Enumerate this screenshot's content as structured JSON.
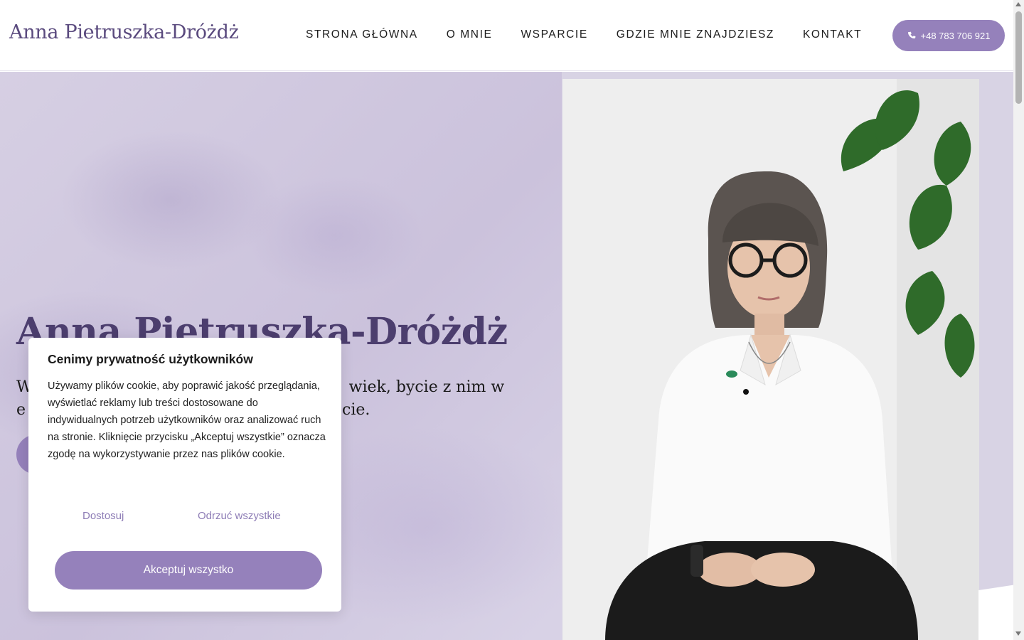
{
  "header": {
    "logo": "Anna Pietruszka-Dróżdż",
    "nav": [
      "STRONA GŁÓWNA",
      "O MNIE",
      "WSPARCIE",
      "GDZIE MNIE ZNAJDZIESZ",
      "KONTAKT"
    ],
    "phone": "+48 783 706 921",
    "phone_icon": "phone-icon"
  },
  "hero": {
    "title": "Anna Pietruszka-Dróżdż",
    "subtitle_line1": "W",
    "subtitle_line1_end": "wiek, bycie z nim w",
    "subtitle_line2": "e",
    "subtitle_line2_end": "cie."
  },
  "cookie": {
    "title": "Cenimy prywatność użytkowników",
    "text": "Używamy plików cookie, aby poprawić jakość przeglądania, wyświetlać reklamy lub treści dostosowane do indywidualnych potrzeb użytkowników oraz analizować ruch na stronie. Kliknięcie przycisku „Akceptuj wszystkie” oznacza zgodę na wykorzystywanie przez nas plików cookie.",
    "customize": "Dostosuj",
    "reject": "Odrzuć wszystkie",
    "accept": "Akceptuj wszystko"
  },
  "colors": {
    "accent": "#9581bb",
    "brand_text": "#5a4a7e"
  }
}
